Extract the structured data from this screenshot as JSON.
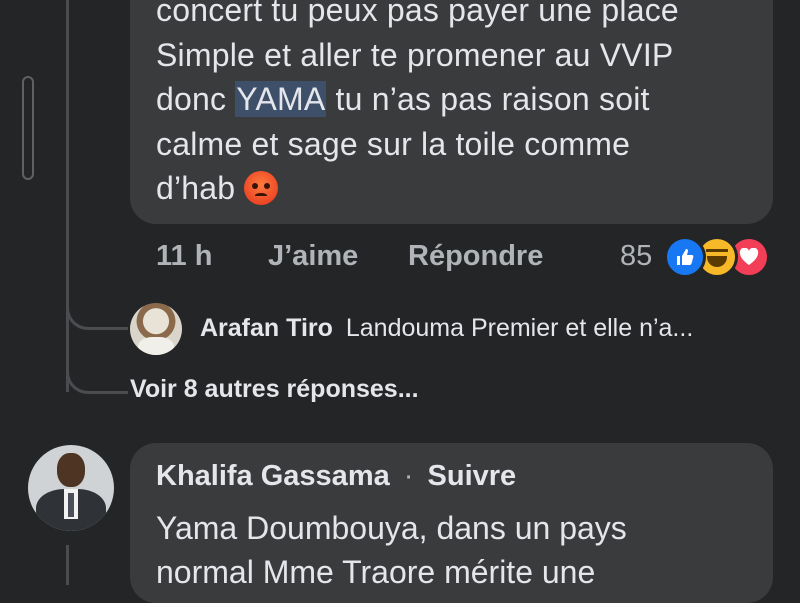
{
  "comment": {
    "lines": [
      "concert tu peux pas payer une place",
      "Simple et aller te promener au VVIP",
      "donc",
      "YAMA",
      "tu n’as pas raison soit",
      "calme et sage sur la toile comme",
      "d’hab"
    ],
    "emoji": "angry-face",
    "time": "11 h",
    "like_label": "J’aime",
    "reply_label": "Répondre",
    "reaction_count": "85",
    "reactions": [
      "like-icon",
      "haha-icon",
      "love-icon"
    ]
  },
  "reply": {
    "author": "Arafan Tiro",
    "preview": "Landouma Premier et elle n’a..."
  },
  "more_replies": "Voir 8 autres réponses...",
  "next_comment": {
    "author": "Khalifa Gassama",
    "separator": "·",
    "follow_label": "Suivre",
    "lines": [
      "Yama Doumbouya,  dans un pays",
      "normal Mme Traore mérite une"
    ]
  },
  "colors": {
    "background": "#242526",
    "bubble": "#3a3b3c",
    "text": "#e4e6eb",
    "secondary_text": "#b0b3b8",
    "like": "#1877f2",
    "haha": "#f7b928",
    "love": "#f33e58"
  }
}
